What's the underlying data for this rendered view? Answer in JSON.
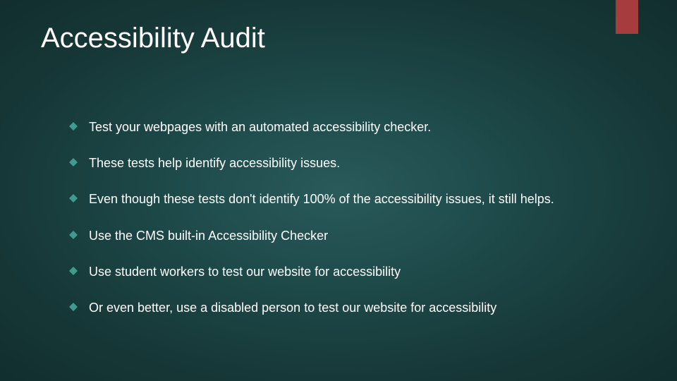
{
  "slide": {
    "title": "Accessibility Audit",
    "bullets": [
      "Test your webpages with an automated accessibility checker.",
      "These tests help identify accessibility issues.",
      "Even though these tests don't identify 100% of the accessibility issues, it still helps.",
      "Use the CMS built-in Accessibility Checker",
      "Use student workers to test our website for accessibility",
      "Or even better, use a disabled person to test our website for accessibility"
    ],
    "accent_color": "#a73c3c",
    "bullet_icon_color": "#3d9c8e"
  }
}
